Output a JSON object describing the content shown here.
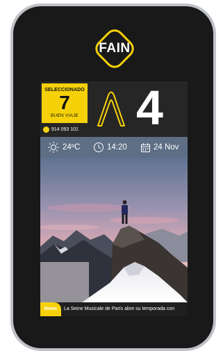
{
  "brand": {
    "name": "FAIN"
  },
  "selection": {
    "title": "SELECCIONADO",
    "floor": "7",
    "subtitle": "BUEN VIAJE"
  },
  "contact": {
    "phone": "914 093 101",
    "icon": "phone-icon"
  },
  "elevator": {
    "direction": "up",
    "direction_icon": "up-arrow-icon",
    "current_floor": "4"
  },
  "info_bar": {
    "temperature": "24ºC",
    "time": "14:20",
    "date": "24 Nov",
    "icons": [
      "sun-icon",
      "clock-icon",
      "calendar-icon"
    ]
  },
  "background_image": {
    "icon": "mountain-landscape"
  },
  "news": {
    "badge": "News",
    "headline": "La Seine Musicale de París abre su temporada con"
  },
  "colors": {
    "accent": "#f6d10a",
    "panel": "#262626",
    "info_bar": "#5d6e85",
    "device_frame": "#191919"
  }
}
